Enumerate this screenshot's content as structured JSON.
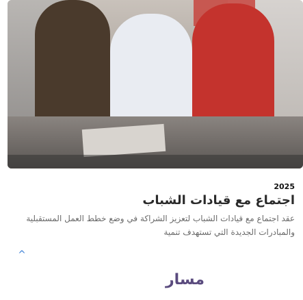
{
  "article": {
    "year": "2025",
    "title": "اجتماع مع قيادات الشباب",
    "description": "عقد اجتماع مع قيادات الشباب لتعزيز الشراكة في وضع خطط العمل المستقبلية والمبادرات الجديدة التي تستهدف تنمية"
  },
  "scroll_top": {
    "icon": "chevron-up-icon",
    "glyph": "^"
  },
  "logo": {
    "text": "مسار"
  },
  "colors": {
    "accent": "#3a7fd5",
    "logo": "#5a4b7e"
  }
}
